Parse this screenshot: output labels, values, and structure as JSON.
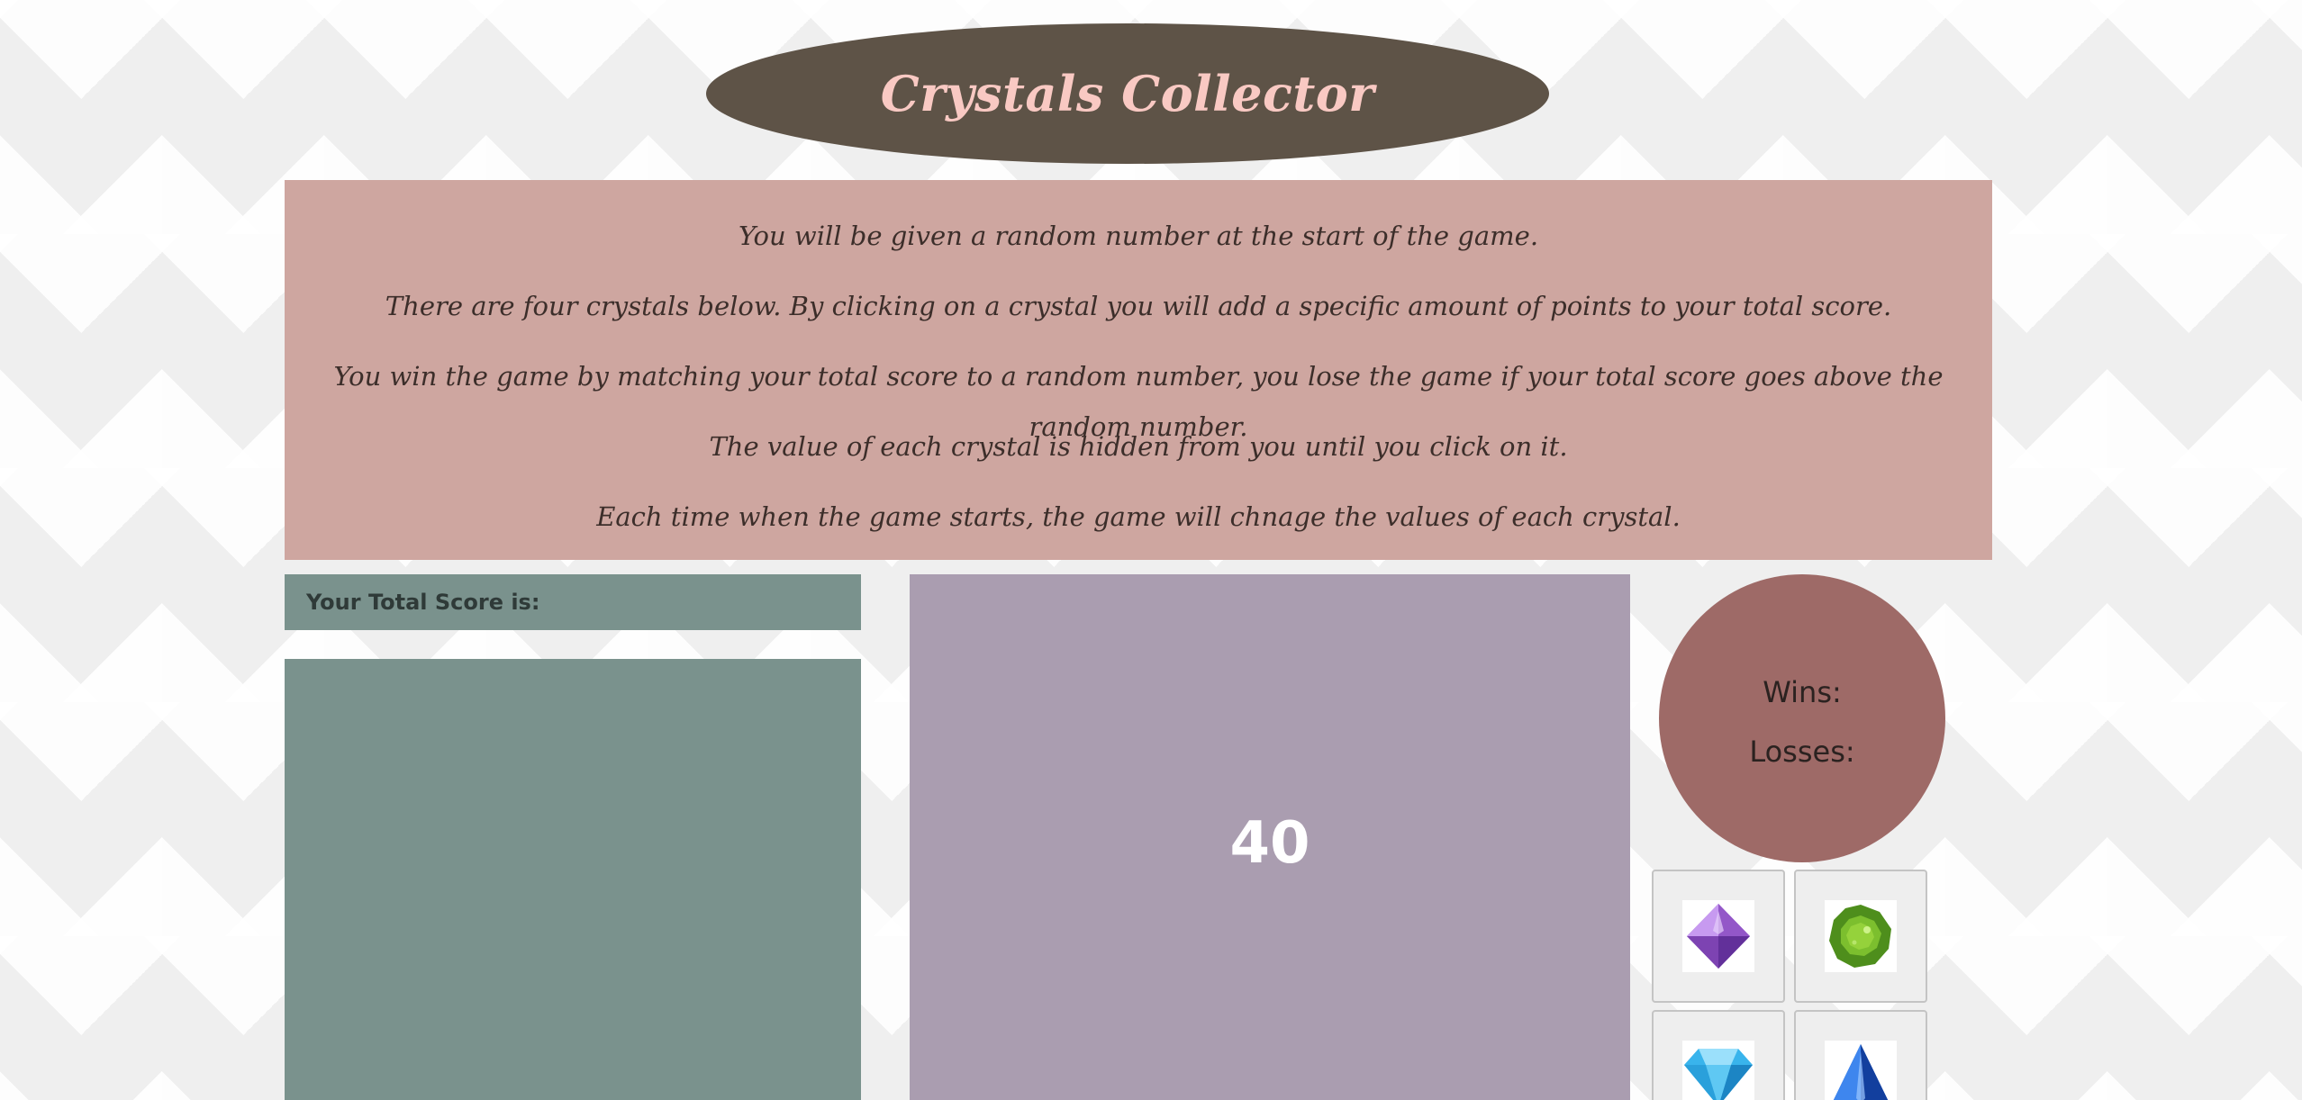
{
  "header": {
    "title": "Crystals Collector"
  },
  "instructions": [
    "You will be given a random number at the start of the game.",
    "There are four crystals below. By clicking on a crystal you will add a specific amount of points to your total score.",
    "You win the game by matching your total score to a random number, you lose the game if your total score goes above the random number.",
    "The value of each crystal is hidden from you until you click on it.",
    "Each time when the game starts, the game will chnage the values of each crystal."
  ],
  "score": {
    "label": "Your Total Score is:"
  },
  "target": {
    "value": "40"
  },
  "record": {
    "wins_label": "Wins:",
    "losses_label": "Losses:"
  },
  "crystals": [
    {
      "icon": "purple-octahedron-crystal-icon"
    },
    {
      "icon": "green-round-gem-icon"
    },
    {
      "icon": "blue-diamond-gem-icon"
    },
    {
      "icon": "blue-pyramid-crystal-icon"
    }
  ],
  "colors": {
    "title_bg": "#5e5347",
    "title_text": "#f9c9c3",
    "instructions_bg": "#cea6a0",
    "score_bg": "#7a928d",
    "target_bg": "#aa9db0",
    "record_bg": "#9e6a67"
  }
}
